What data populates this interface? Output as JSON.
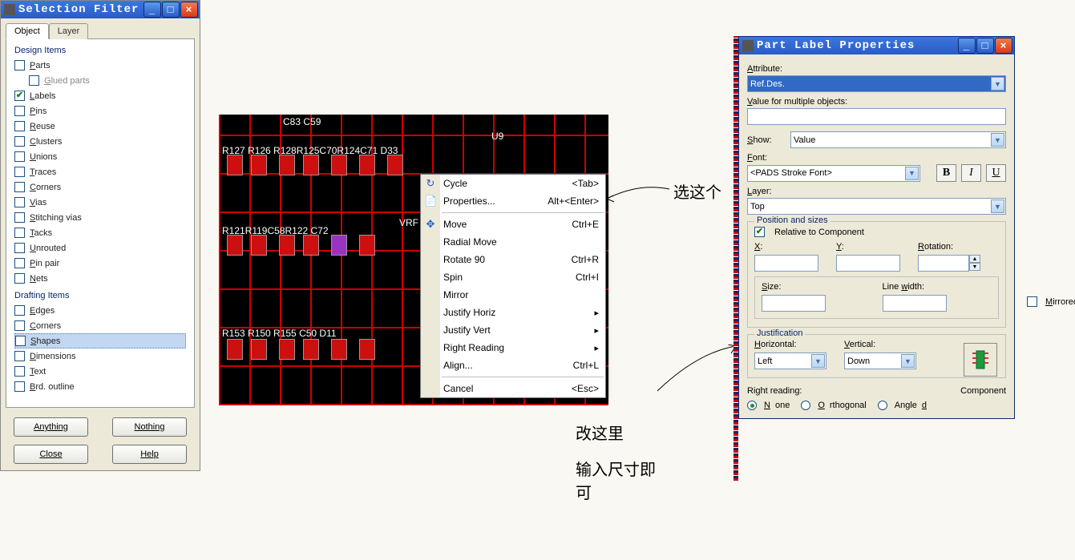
{
  "selection_filter": {
    "title": "Selection Filter",
    "tabs": {
      "object": "Object",
      "layer": "Layer"
    },
    "design_items_title": "Design Items",
    "drafting_items_title": "Drafting Items",
    "items_design": [
      {
        "label": "Parts",
        "ul": "P",
        "checked": false,
        "indent": false
      },
      {
        "label": "Glued parts",
        "ul": "G",
        "checked": false,
        "indent": true
      },
      {
        "label": "Labels",
        "ul": "L",
        "checked": true,
        "indent": false
      },
      {
        "label": "Pins",
        "ul": "P",
        "checked": false,
        "indent": false
      },
      {
        "label": "Reuse",
        "ul": "R",
        "checked": false,
        "indent": false
      },
      {
        "label": "Clusters",
        "ul": "C",
        "checked": false,
        "indent": false
      },
      {
        "label": "Unions",
        "ul": "U",
        "checked": false,
        "indent": false
      },
      {
        "label": "Traces",
        "ul": "T",
        "checked": false,
        "indent": false
      },
      {
        "label": "Corners",
        "ul": "C",
        "checked": false,
        "indent": false
      },
      {
        "label": "Vias",
        "ul": "V",
        "checked": false,
        "indent": false
      },
      {
        "label": "Stitching vias",
        "ul": "S",
        "checked": false,
        "indent": false
      },
      {
        "label": "Tacks",
        "ul": "T",
        "checked": false,
        "indent": false
      },
      {
        "label": "Unrouted",
        "ul": "U",
        "checked": false,
        "indent": false
      },
      {
        "label": "Pin pair",
        "ul": "P",
        "checked": false,
        "indent": false
      },
      {
        "label": "Nets",
        "ul": "N",
        "checked": false,
        "indent": false
      }
    ],
    "items_drafting": [
      {
        "label": "Edges",
        "ul": "E",
        "checked": false
      },
      {
        "label": "Corners",
        "ul": "C",
        "checked": false
      },
      {
        "label": "Shapes",
        "ul": "S",
        "checked": false,
        "selected": true
      },
      {
        "label": "Dimensions",
        "ul": "D",
        "checked": false
      },
      {
        "label": "Text",
        "ul": "T",
        "checked": false
      },
      {
        "label": "Brd. outline",
        "ul": "B",
        "checked": false
      }
    ],
    "buttons": {
      "anything": "Anything",
      "nothing": "Nothing",
      "close": "Close",
      "help": "Help"
    }
  },
  "pcb_refs": {
    "row1": "R127 R126 R128R125C70R124C71 D33",
    "row1b": "U9",
    "row2": "R121R119C58R122 C72",
    "row2b": "VRF",
    "row3": "R153 R150 R155 C50 D11",
    "rowtop": "C83                          C59"
  },
  "context_menu": [
    {
      "label": "Cycle",
      "shortcut": "<Tab>",
      "icon": "↻"
    },
    {
      "label": "Properties...",
      "shortcut": "Alt+<Enter>",
      "icon": "📄"
    },
    {
      "sep": true
    },
    {
      "label": "Move",
      "shortcut": "Ctrl+E",
      "icon": "✥"
    },
    {
      "label": "Radial Move",
      "shortcut": ""
    },
    {
      "label": "Rotate 90",
      "shortcut": "Ctrl+R"
    },
    {
      "label": "Spin",
      "shortcut": "Ctrl+I"
    },
    {
      "label": "Mirror",
      "shortcut": ""
    },
    {
      "label": "Justify Horiz",
      "submenu": true
    },
    {
      "label": "Justify Vert",
      "submenu": true
    },
    {
      "label": "Right Reading",
      "submenu": true
    },
    {
      "label": "Align...",
      "shortcut": "Ctrl+L"
    },
    {
      "sep": true
    },
    {
      "label": "Cancel",
      "shortcut": "<Esc>"
    }
  ],
  "annotations": {
    "select_this": "选这个",
    "change_here": "改这里",
    "input_size": "输入尺寸即可"
  },
  "part_label": {
    "title": "Part Label Properties",
    "attribute_label": "Attribute:",
    "attribute_value": "Ref.Des.",
    "value_multi_label": "Value for multiple objects:",
    "value_multi": "",
    "show_label": "Show:",
    "show_value": "Value",
    "font_label": "Font:",
    "font_value": "<PADS Stroke Font>",
    "style": {
      "b": "B",
      "i": "I",
      "u": "U"
    },
    "layer_label": "Layer:",
    "layer_value": "Top",
    "pos_sizes_legend": "Position and sizes",
    "relative_label": "Relative to Component",
    "x_label": "X:",
    "y_label": "Y:",
    "rotation_label": "Rotation:",
    "size_label": "Size:",
    "linewidth_label": "Line width:",
    "mirrored_label": "Mirrored",
    "x": "",
    "y": "",
    "rotation": "",
    "size": "",
    "linewidth": "",
    "just_legend": "Justification",
    "horiz_label": "Horizontal:",
    "vert_label": "Vertical:",
    "horiz_value": "Left",
    "vert_value": "Down",
    "right_reading_label": "Right reading:",
    "component_label": "Component",
    "rr_none": "None",
    "rr_orth": "Orthogonal",
    "rr_ang": "Angled"
  }
}
